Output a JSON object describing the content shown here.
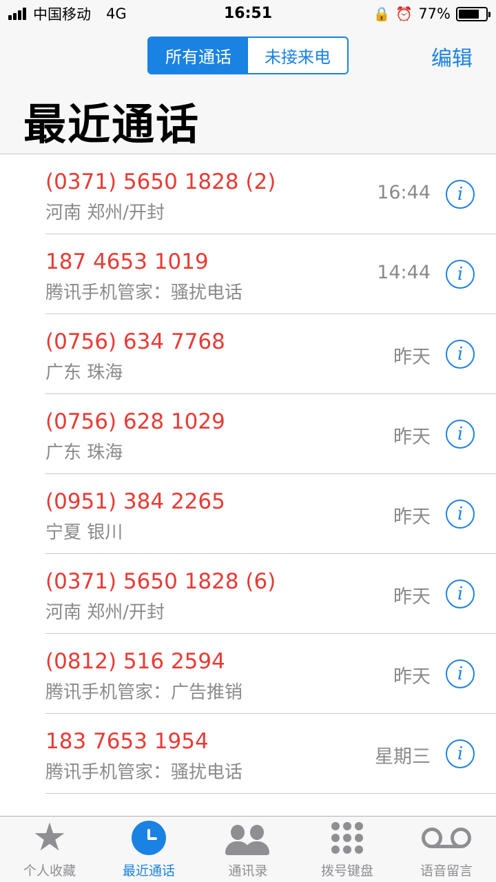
{
  "status_bar": {
    "carrier": "中国移动",
    "network": "4G",
    "time": "16:51",
    "orientation_lock_icon": "rotation-lock-icon",
    "alarm_icon": "alarm-clock-icon",
    "battery_percent": "77%",
    "battery_level": 0.77
  },
  "nav": {
    "segments": [
      "所有通话",
      "未接来电"
    ],
    "selected_segment": 0,
    "edit_label": "编辑",
    "title": "最近通话"
  },
  "calls": [
    {
      "number": "(0371) 5650 1828 (2)",
      "label": "河南 郑州/开封",
      "time": "16:44"
    },
    {
      "number": "187 4653 1019",
      "label": "腾讯手机管家：骚扰电话",
      "time": "14:44"
    },
    {
      "number": "(0756) 634 7768",
      "label": "广东 珠海",
      "time": "昨天"
    },
    {
      "number": "(0756) 628 1029",
      "label": "广东 珠海",
      "time": "昨天"
    },
    {
      "number": "(0951) 384 2265",
      "label": "宁夏 银川",
      "time": "昨天"
    },
    {
      "number": "(0371) 5650 1828 (6)",
      "label": "河南 郑州/开封",
      "time": "昨天"
    },
    {
      "number": "(0812) 516 2594",
      "label": "腾讯手机管家：广告推销",
      "time": "昨天"
    },
    {
      "number": "183 7653 1954",
      "label": "腾讯手机管家：骚扰电话",
      "time": "星期三"
    }
  ],
  "info_glyph": "i",
  "colors": {
    "accent": "#1a82e2",
    "missed_call": "#e73b34",
    "secondary_text": "#8a8a8a"
  },
  "tabs": [
    {
      "label": "个人收藏",
      "icon": "star-icon"
    },
    {
      "label": "最近通话",
      "icon": "clock-icon"
    },
    {
      "label": "通讯录",
      "icon": "contacts-icon"
    },
    {
      "label": "拨号键盘",
      "icon": "keypad-icon"
    },
    {
      "label": "语音留言",
      "icon": "voicemail-icon"
    }
  ],
  "selected_tab": 1
}
